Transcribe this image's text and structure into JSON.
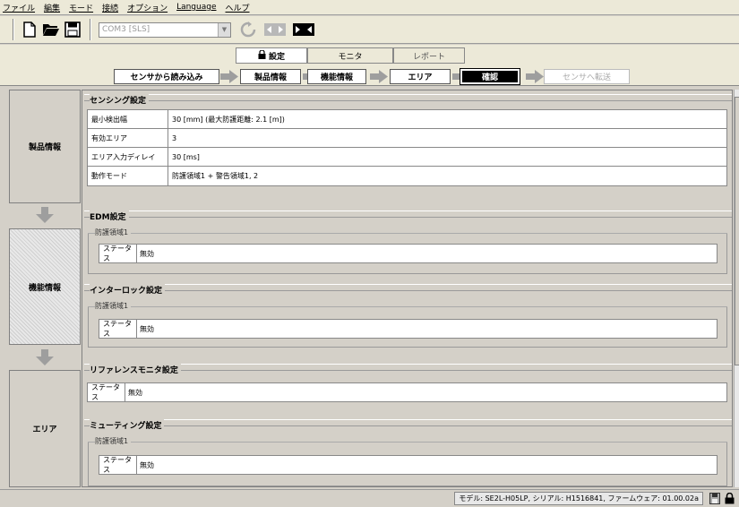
{
  "menu": [
    "ファイル",
    "編集",
    "モード",
    "接続",
    "オプション",
    "Language",
    "ヘルプ"
  ],
  "toolbar": {
    "new_icon": "new-file-icon",
    "open_icon": "open-folder-icon",
    "save_icon": "save-icon",
    "com_port": "COM3 [SLS]",
    "refresh_icon": "refresh-icon",
    "disconnect_icon": "disconnect-icon",
    "connect_icon": "connect-icon"
  },
  "mode_tabs": [
    {
      "label": "設定",
      "active": true
    },
    {
      "label": "モニタ",
      "active": false
    },
    {
      "label": "レポート",
      "active": false
    }
  ],
  "steps": [
    {
      "label": "センサから読み込み",
      "state": "normal"
    },
    {
      "label": "製品情報",
      "state": "normal"
    },
    {
      "label": "機能情報",
      "state": "normal"
    },
    {
      "label": "エリア",
      "state": "normal"
    },
    {
      "label": "確認",
      "state": "active"
    },
    {
      "label": "センサへ転送",
      "state": "disabled"
    }
  ],
  "nav": {
    "product": "製品情報",
    "function": "機能情報",
    "area": "エリア"
  },
  "sensing": {
    "title": "センシング設定",
    "rows": [
      {
        "label": "最小検出幅",
        "value": "30 [mm] (最大防護距離: 2.1 [m])"
      },
      {
        "label": "有効エリア",
        "value": "3"
      },
      {
        "label": "エリア入力ディレイ",
        "value": "30 [ms]"
      },
      {
        "label": "動作モード",
        "value": "防護領域1 + 警告領域1, 2"
      }
    ]
  },
  "edm": {
    "title": "EDM設定",
    "sub": "防護領域1",
    "status_label": "ステータス",
    "status_value": "無効"
  },
  "interlock": {
    "title": "インターロック設定",
    "sub": "防護領域1",
    "status_label": "ステータス",
    "status_value": "無効"
  },
  "reference": {
    "title": "リファレンスモニタ設定",
    "status_label": "ステータス",
    "status_value": "無効"
  },
  "muting": {
    "title": "ミューティング設定",
    "sub": "防護領域1",
    "status_label": "ステータス",
    "status_value": "無効"
  },
  "status_bar": {
    "model_info": "モデル: SE2L-H05LP, シリアル: H1516841, ファームウェア: 01.00.02a",
    "save_icon": "save-icon",
    "lock_icon": "lock-icon"
  },
  "colors": {
    "window_bg": "#d4d0c8",
    "arrow": "#9e9e9e",
    "active_step": "#000000"
  }
}
